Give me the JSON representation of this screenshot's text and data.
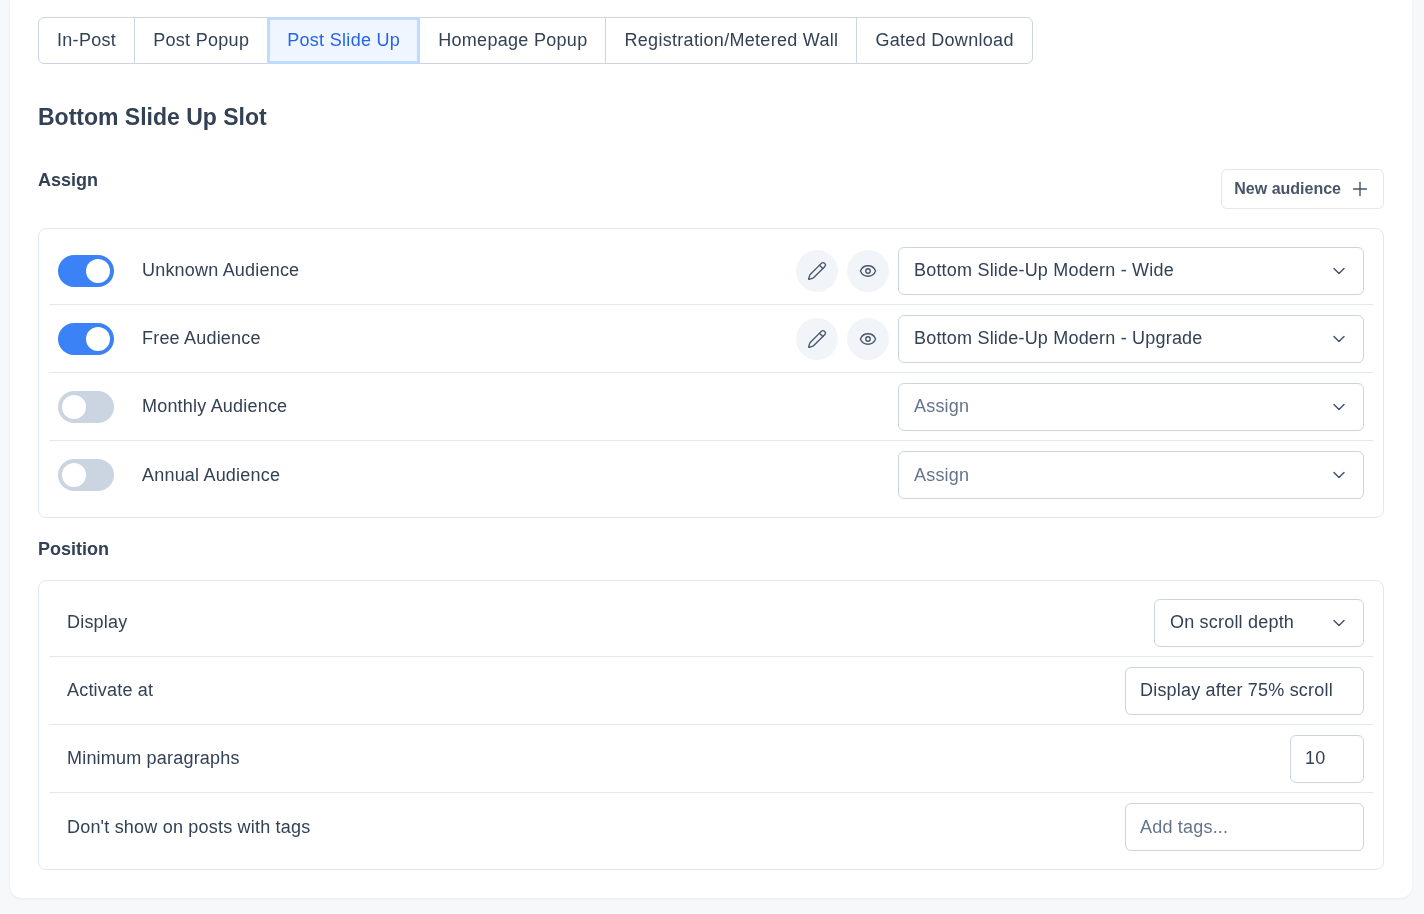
{
  "tabs": [
    {
      "label": "In-Post",
      "selected": false
    },
    {
      "label": "Post Popup",
      "selected": false
    },
    {
      "label": "Post Slide Up",
      "selected": true
    },
    {
      "label": "Homepage Popup",
      "selected": false
    },
    {
      "label": "Registration/Metered Wall",
      "selected": false
    },
    {
      "label": "Gated Download",
      "selected": false
    }
  ],
  "slot_title": "Bottom Slide Up Slot",
  "assign": {
    "heading": "Assign",
    "new_audience_button": "New audience",
    "audiences": [
      {
        "name": "Unknown Audience",
        "on": true,
        "template": {
          "value": "Bottom Slide-Up Modern - Wide"
        }
      },
      {
        "name": "Free Audience",
        "on": true,
        "template": {
          "value": "Bottom Slide-Up Modern - Upgrade"
        }
      },
      {
        "name": "Monthly Audience",
        "on": false,
        "template": {
          "placeholder": "Assign"
        }
      },
      {
        "name": "Annual Audience",
        "on": false,
        "template": {
          "placeholder": "Assign"
        }
      }
    ]
  },
  "position": {
    "heading": "Position",
    "rows": [
      {
        "kind": "select",
        "label": "Display",
        "value": "On scroll depth"
      },
      {
        "kind": "text",
        "label": "Activate at",
        "value": "Display after 75% scroll"
      },
      {
        "kind": "number",
        "label": "Minimum paragraphs",
        "value": "10"
      },
      {
        "kind": "tags",
        "label": "Don't show on posts with tags",
        "placeholder": "Add tags..."
      }
    ]
  }
}
